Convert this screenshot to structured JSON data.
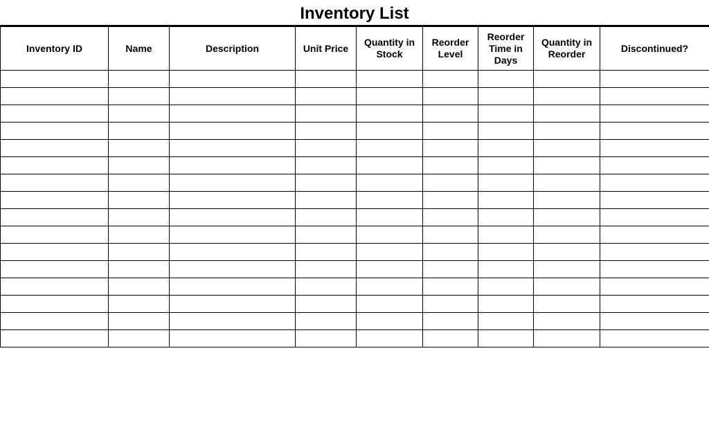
{
  "title": "Inventory List",
  "columns": [
    "Inventory ID",
    "Name",
    "Description",
    "Unit Price",
    "Quantity in Stock",
    "Reorder Level",
    "Reorder Time in Days",
    "Quantity in Reorder",
    "Discontinued?"
  ],
  "rows": [
    [
      "",
      "",
      "",
      "",
      "",
      "",
      "",
      "",
      ""
    ],
    [
      "",
      "",
      "",
      "",
      "",
      "",
      "",
      "",
      ""
    ],
    [
      "",
      "",
      "",
      "",
      "",
      "",
      "",
      "",
      ""
    ],
    [
      "",
      "",
      "",
      "",
      "",
      "",
      "",
      "",
      ""
    ],
    [
      "",
      "",
      "",
      "",
      "",
      "",
      "",
      "",
      ""
    ],
    [
      "",
      "",
      "",
      "",
      "",
      "",
      "",
      "",
      ""
    ],
    [
      "",
      "",
      "",
      "",
      "",
      "",
      "",
      "",
      ""
    ],
    [
      "",
      "",
      "",
      "",
      "",
      "",
      "",
      "",
      ""
    ],
    [
      "",
      "",
      "",
      "",
      "",
      "",
      "",
      "",
      ""
    ],
    [
      "",
      "",
      "",
      "",
      "",
      "",
      "",
      "",
      ""
    ],
    [
      "",
      "",
      "",
      "",
      "",
      "",
      "",
      "",
      ""
    ],
    [
      "",
      "",
      "",
      "",
      "",
      "",
      "",
      "",
      ""
    ],
    [
      "",
      "",
      "",
      "",
      "",
      "",
      "",
      "",
      ""
    ],
    [
      "",
      "",
      "",
      "",
      "",
      "",
      "",
      "",
      ""
    ],
    [
      "",
      "",
      "",
      "",
      "",
      "",
      "",
      "",
      ""
    ],
    [
      "",
      "",
      "",
      "",
      "",
      "",
      "",
      "",
      ""
    ]
  ]
}
